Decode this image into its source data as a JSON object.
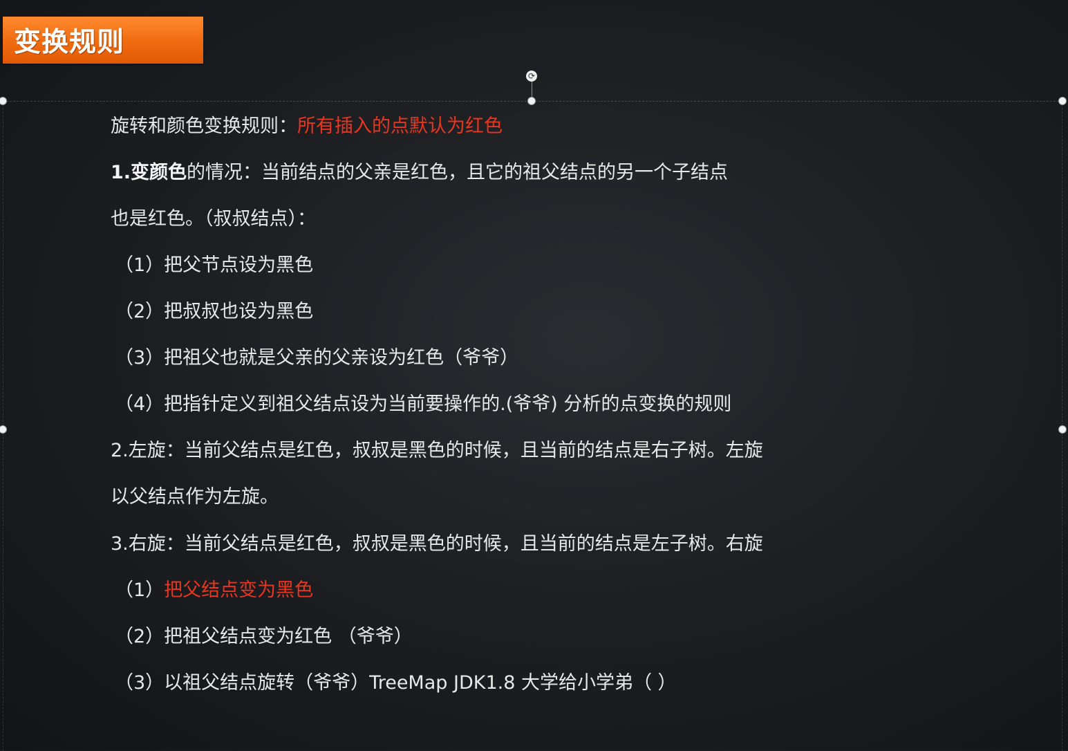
{
  "slide": {
    "title": "变换规则",
    "lines": {
      "l1_label": "旋转和颜色变换规则：",
      "l1_red": "所有插入的点默认为红色",
      "l2_bold": "1.变颜色",
      "l2_rest": "的情况：当前结点的父亲是红色，且它的祖父结点的另一个子结点",
      "l3": "也是红色。（叔叔结点）：",
      "l4": "（1）把父节点设为黑色",
      "l5": "（2）把叔叔也设为黑色",
      "l6": "（3）把祖父也就是父亲的父亲设为红色（爷爷）",
      "l7": "（4）把指针定义到祖父结点设为当前要操作的.(爷爷) 分析的点变换的规则",
      "l8": "2.左旋：当前父结点是红色，叔叔是黑色的时候，且当前的结点是右子树。左旋",
      "l9": "以父结点作为左旋。",
      "l10": "3.右旋：当前父结点是红色，叔叔是黑色的时候，且当前的结点是左子树。右旋",
      "l11_prefix": "（1）",
      "l11_red": "把父结点变为黑色",
      "l12": "（2）把祖父结点变为红色 （爷爷）",
      "l13": "（3）以祖父结点旋转（爷爷）TreeMap JDK1.8 大学给小学弟（ ）"
    }
  },
  "colors": {
    "title_bg": "#f06b10",
    "highlight": "#e8361f",
    "text": "#e8e8e8"
  },
  "icons": {
    "rotate": "rotate-handle-icon"
  }
}
